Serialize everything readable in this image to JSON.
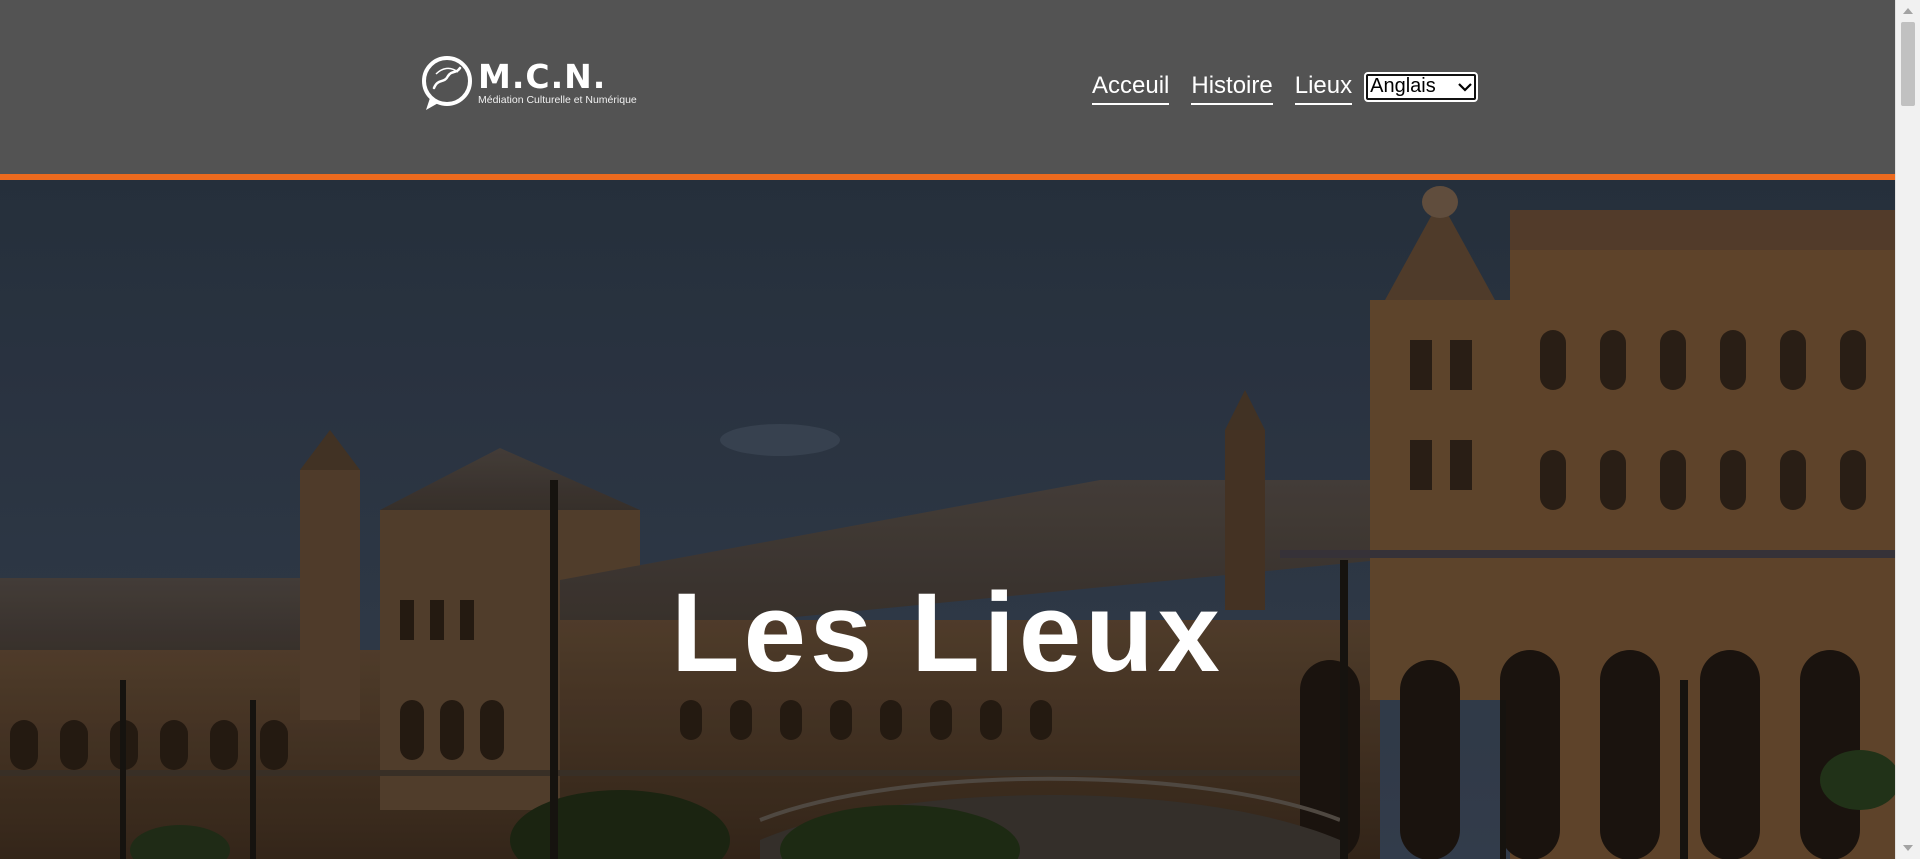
{
  "header": {
    "logo": {
      "title": "M.C.N.",
      "subtitle": "Médiation Culturelle et Numérique"
    },
    "nav": [
      {
        "label": "Acceuil"
      },
      {
        "label": "Histoire"
      },
      {
        "label": "Lieux"
      }
    ],
    "language_select": {
      "selected": "Anglais"
    }
  },
  "hero": {
    "title": "Les Lieux"
  },
  "colors": {
    "header_bg": "#535353",
    "accent": "#ec6a1e",
    "text": "#ffffff"
  }
}
